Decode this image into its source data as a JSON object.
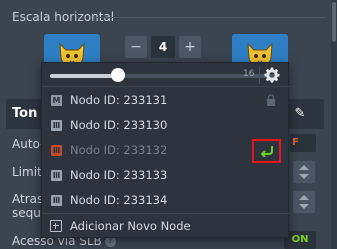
{
  "section": {
    "title": "Escala horizontal"
  },
  "stepper": {
    "minus": "−",
    "value": "4",
    "plus": "+"
  },
  "settings_rows": [
    {
      "label": "Ton"
    },
    {
      "label": "Auto-"
    },
    {
      "label": "Limite"
    },
    {
      "label": "Atras"
    },
    {
      "label": "seque"
    },
    {
      "label": "Acesso via SLB"
    }
  ],
  "toggle_off_partial": "F",
  "toggle_on": "ON",
  "slider": {
    "max_label": "16",
    "value_fraction": 0.3
  },
  "nodes": [
    {
      "label": "Nodo ID: 233131",
      "role": "master",
      "glyph": "M",
      "locked": true
    },
    {
      "label": "Nodo ID: 233130",
      "role": "worker",
      "glyph": "Ⅲ"
    },
    {
      "label": "Nodo ID: 233132",
      "role": "disabled",
      "glyph": "Ⅲ",
      "restorable": true
    },
    {
      "label": "Nodo ID: 233133",
      "role": "worker",
      "glyph": "Ⅲ"
    },
    {
      "label": "Nodo ID: 233134",
      "role": "worker",
      "glyph": "Ⅲ"
    }
  ],
  "add_node": {
    "label": "Adicionar Novo Node"
  },
  "colors": {
    "accent_highlight": "#e8141a",
    "restore_green": "#6fcf2a",
    "disabled_node": "#c24b2c"
  }
}
